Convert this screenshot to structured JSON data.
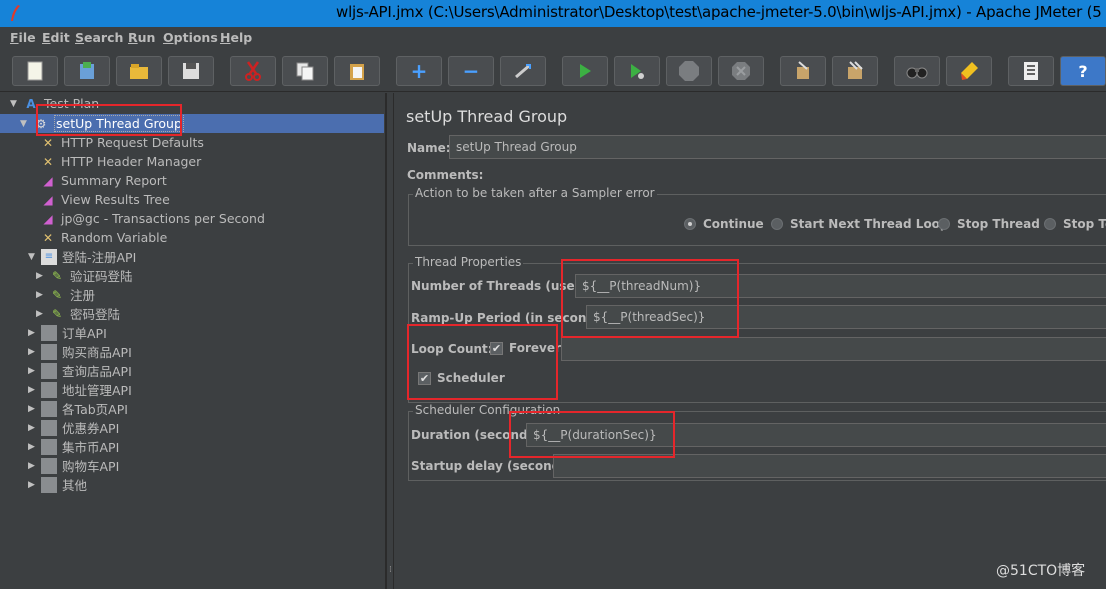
{
  "window": {
    "title": "wljs-API.jmx (C:\\Users\\Administrator\\Desktop\\test\\apache-jmeter-5.0\\bin\\wljs-API.jmx) - Apache JMeter (5"
  },
  "menu": [
    "File",
    "Edit",
    "Search",
    "Run",
    "Options",
    "Help"
  ],
  "toolbar": {
    "icons": [
      "new-icon",
      "templates-icon",
      "open-icon",
      "save-icon",
      "cut-icon",
      "copy-icon",
      "paste-icon",
      "expand-icon",
      "collapse-icon",
      "toggle-icon",
      "start-icon",
      "start-no-pauses-icon",
      "stop-icon",
      "shutdown-icon",
      "clear-icon",
      "clear-all-icon",
      "search-icon",
      "reset-search-icon",
      "function-helper-icon",
      "help-icon"
    ],
    "glyphs": {
      "expand": "+",
      "collapse": "−",
      "help": "?"
    }
  },
  "tree": {
    "root": "Test Plan",
    "selected": "setUp Thread Group",
    "children": [
      "HTTP Request Defaults",
      "HTTP Header Manager",
      "Summary Report",
      "View Results Tree",
      "jp@gc - Transactions per Second",
      "Random Variable"
    ],
    "controller": "登陆-注册API",
    "controller_children": [
      "验证码登陆",
      "注册",
      "密码登陆"
    ],
    "groups": [
      "订单API",
      "购买商品API",
      "查询店品API",
      "地址管理API",
      "各Tab页API",
      "优惠券API",
      "集市币API",
      "购物车API",
      "其他"
    ]
  },
  "panel": {
    "title": "setUp Thread Group",
    "name_label": "Name:",
    "name_value": "setUp Thread Group",
    "comments_label": "Comments:",
    "error_group_label": "Action to be taken after a Sampler error",
    "error_options": [
      "Continue",
      "Start Next Thread Loop",
      "Stop Thread",
      "Stop Te"
    ],
    "selected_error_option": "Continue",
    "thread_props_label": "Thread Properties",
    "threads_label": "Number of Threads (users):",
    "threads_value": "${__P(threadNum)}",
    "rampup_label": "Ramp-Up Period (in seconds):",
    "rampup_value": "${__P(threadSec)}",
    "loop_label": "Loop Count:",
    "forever_label": "Forever",
    "forever_checked": true,
    "scheduler_label": "Scheduler",
    "scheduler_checked": true,
    "sched_config_label": "Scheduler Configuration",
    "duration_label": "Duration (seconds)",
    "duration_value": "${__P(durationSec)}",
    "startup_label": "Startup delay (seconds)",
    "startup_value": ""
  },
  "watermark": "@51CTO博客",
  "colors": {
    "background": "#3c3f41",
    "titlebar": "#1683d8",
    "selection": "#4b6eaf",
    "annotation": "#e5262b"
  }
}
